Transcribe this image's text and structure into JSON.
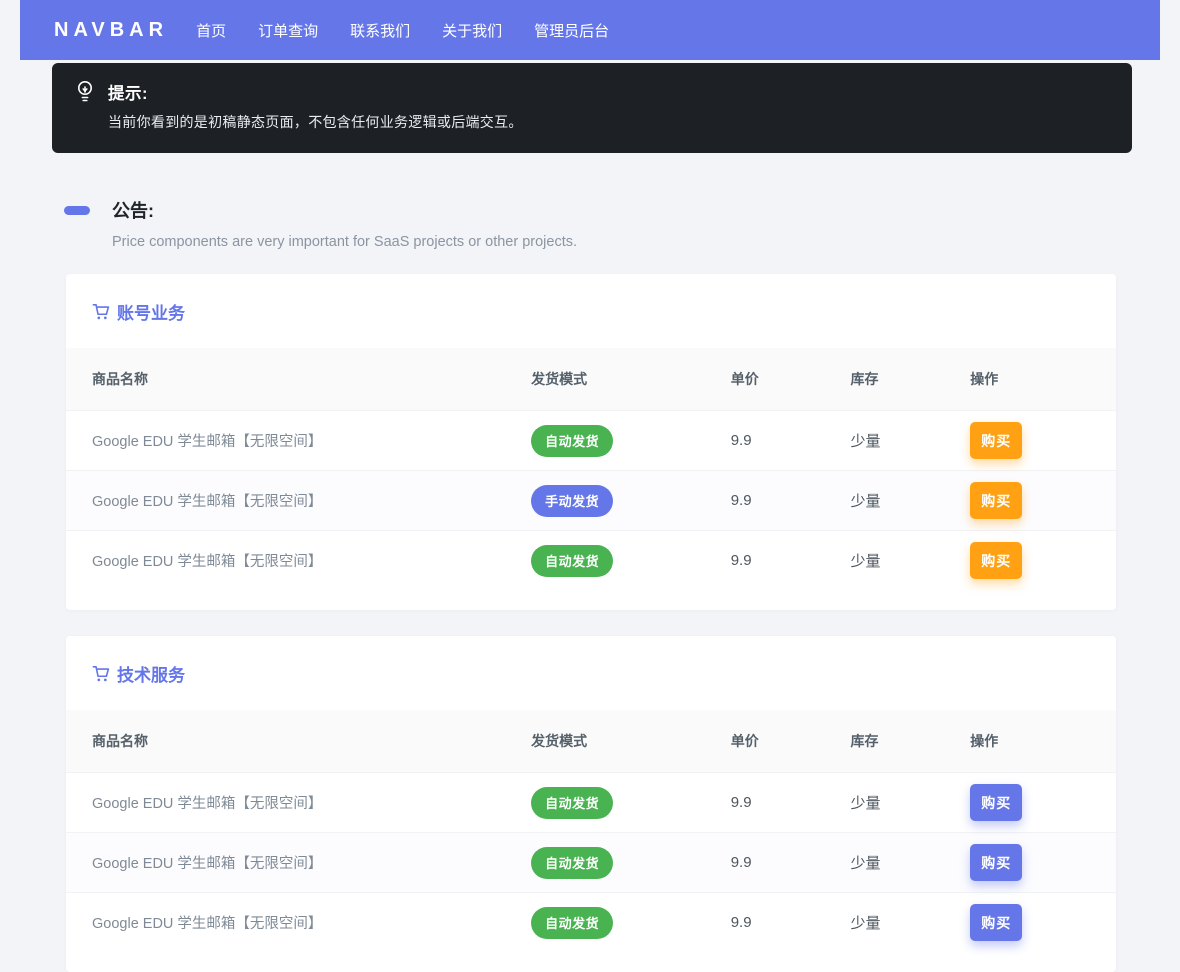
{
  "navbar": {
    "brand": "NAVBAR",
    "items": [
      {
        "label": "首页"
      },
      {
        "label": "订单查询"
      },
      {
        "label": "联系我们"
      },
      {
        "label": "关于我们"
      },
      {
        "label": "管理员后台"
      }
    ]
  },
  "notice": {
    "title": "提示:",
    "body": "当前你看到的是初稿静态页面，不包含任何业务逻辑或后端交互。"
  },
  "announcement": {
    "title": "公告:",
    "body": "Price components are very important for SaaS projects or other projects."
  },
  "columns": [
    "商品名称",
    "发货模式",
    "单价",
    "库存",
    "操作"
  ],
  "sections": [
    {
      "title": "账号业务",
      "rows": [
        {
          "name": "Google EDU 学生邮箱【无限空间】",
          "mode": "自动发货",
          "price": "9.9",
          "stock": "少量",
          "action": "购买"
        },
        {
          "name": "Google EDU 学生邮箱【无限空间】",
          "mode": "手动发货",
          "price": "9.9",
          "stock": "少量",
          "action": "购买"
        },
        {
          "name": "Google EDU 学生邮箱【无限空间】",
          "mode": "自动发货",
          "price": "9.9",
          "stock": "少量",
          "action": "购买"
        }
      ]
    },
    {
      "title": "技术服务",
      "rows": [
        {
          "name": "Google EDU 学生邮箱【无限空间】",
          "mode": "自动发货",
          "price": "9.9",
          "stock": "少量",
          "action": "购买"
        },
        {
          "name": "Google EDU 学生邮箱【无限空间】",
          "mode": "自动发货",
          "price": "9.9",
          "stock": "少量",
          "action": "购买"
        },
        {
          "name": "Google EDU 学生邮箱【无限空间】",
          "mode": "自动发货",
          "price": "9.9",
          "stock": "少量",
          "action": "购买"
        }
      ]
    }
  ],
  "colors": {
    "accent_indigo": "#6577e8",
    "badge_green": "#49b351",
    "button_orange": "#ffa113",
    "notice_bg": "#1d2125",
    "page_bg": "#f3f4f8"
  }
}
